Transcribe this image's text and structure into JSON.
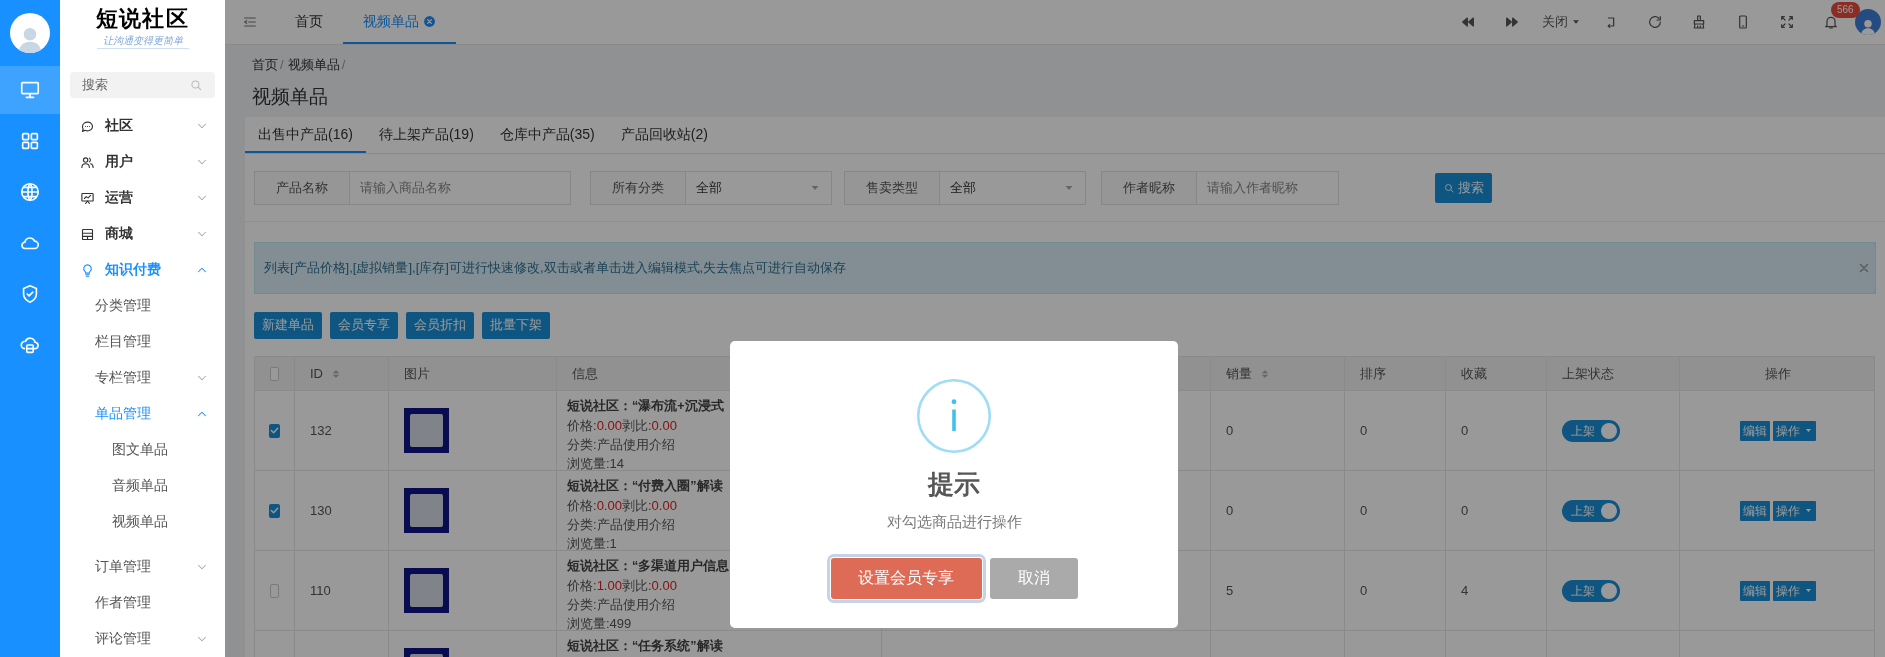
{
  "rail": {
    "items": [
      {
        "selected": true
      },
      {
        "selected": false
      },
      {
        "selected": false
      },
      {
        "selected": false
      },
      {
        "selected": false
      },
      {
        "selected": false
      }
    ]
  },
  "logo": {
    "title": "短说社区",
    "slogan": "让沟通变得更简单"
  },
  "sidebar": {
    "search_placeholder": "搜索",
    "items": [
      {
        "label": "社区",
        "active": false,
        "expanded": false
      },
      {
        "label": "用户",
        "active": false,
        "expanded": false
      },
      {
        "label": "运营",
        "active": false,
        "expanded": false
      },
      {
        "label": "商城",
        "active": false,
        "expanded": false
      },
      {
        "label": "知识付费",
        "active": true,
        "expanded": true,
        "children": [
          {
            "label": "分类管理",
            "active": false
          },
          {
            "label": "栏目管理",
            "active": false
          },
          {
            "label": "专栏管理",
            "active": false,
            "expanded": false
          },
          {
            "label": "单品管理",
            "active": true,
            "expanded": true,
            "children": [
              {
                "label": "图文单品",
                "active": false
              },
              {
                "label": "音频单品",
                "active": false
              },
              {
                "label": "视频单品",
                "active": false
              }
            ]
          },
          {
            "label": "订单管理",
            "active": false,
            "expanded": false
          },
          {
            "label": "作者管理",
            "active": false
          },
          {
            "label": "评论管理",
            "active": false,
            "expanded": false
          }
        ]
      }
    ]
  },
  "top_tabs": [
    {
      "label": "首页",
      "selected": false,
      "closable": false
    },
    {
      "label": "视频单品",
      "selected": true,
      "closable": true
    }
  ],
  "toolbar": {
    "close_menu": "关闭",
    "notification_count": "566"
  },
  "breadcrumb": [
    {
      "label": "首页",
      "separator": "/"
    },
    {
      "label": "视频单品",
      "separator": "/"
    }
  ],
  "page_title": "视频单品",
  "content_tabs": [
    {
      "label": "出售中产品(16)",
      "selected": true
    },
    {
      "label": "待上架产品(19)",
      "selected": false
    },
    {
      "label": "仓库中产品(35)",
      "selected": false
    },
    {
      "label": "产品回收站(2)",
      "selected": false
    }
  ],
  "filters": [
    {
      "kind": "text",
      "label": "产品名称",
      "placeholder": "请输入商品名称"
    },
    {
      "kind": "select",
      "label": "所有分类",
      "value": "全部"
    },
    {
      "kind": "select",
      "label": "售卖类型",
      "value": "全部"
    },
    {
      "kind": "text",
      "label": "作者昵称",
      "placeholder": "请输入作者昵称"
    }
  ],
  "search_button": "搜索",
  "notice": "列表[产品价格],[虚拟销量],[库存]可进行快速修改,双击或者单击进入编辑模式,失去焦点可进行自动保存",
  "actions": [
    "新建单品",
    "会员专享",
    "会员折扣",
    "批量下架"
  ],
  "table": {
    "all_checked": false,
    "columns": [
      {
        "label": "ID",
        "sortable": true
      },
      {
        "label": "图片",
        "sortable": false
      },
      {
        "label": "信息",
        "sortable": false
      },
      {
        "label": "销量",
        "sortable": true
      },
      {
        "label": "排序",
        "sortable": false
      },
      {
        "label": "收藏",
        "sortable": false
      },
      {
        "label": "上架状态",
        "sortable": false
      },
      {
        "label": "操作",
        "sortable": false
      }
    ],
    "rows": [
      {
        "checked": true,
        "id": "132",
        "title": "短说社区：“瀑布流+沉浸式",
        "price_label": "价格:",
        "price": "0.00",
        "ratio_label": "剥比:",
        "ratio": "0.00",
        "category": "分类:产品使用介绍",
        "views": "浏览量:14",
        "sales": "0",
        "sort": "0",
        "favorites": "0",
        "status": {
          "label": "上架",
          "on": true
        },
        "buttons": [
          "编辑",
          "操作"
        ]
      },
      {
        "checked": true,
        "id": "130",
        "title": "短说社区：“付费入圈”解读",
        "price_label": "价格:",
        "price": "0.00",
        "ratio_label": "剥比:",
        "ratio": "0.00",
        "category": "分类:产品使用介绍",
        "views": "浏览量:1",
        "sales": "0",
        "sort": "0",
        "favorites": "0",
        "status": {
          "label": "上架",
          "on": true
        },
        "buttons": [
          "编辑",
          "操作"
        ]
      },
      {
        "checked": false,
        "id": "110",
        "title": "短说社区：“多渠道用户信息",
        "price_label": "价格:",
        "price": "1.00",
        "ratio_label": "剥比:",
        "ratio": "0.00",
        "category": "分类:产品使用介绍",
        "views": "浏览量:499",
        "sales": "5",
        "sort": "0",
        "favorites": "4",
        "status": {
          "label": "上架",
          "on": true
        },
        "buttons": [
          "编辑",
          "操作"
        ]
      },
      {
        "title": "短说社区：“任务系统”解读"
      }
    ]
  },
  "dialog": {
    "title": "提示",
    "message": "对勾选商品进行操作",
    "buttons": [
      {
        "kind": "primary",
        "label": "设置会员专享",
        "focused": true
      },
      {
        "kind": "cancel",
        "label": "取消",
        "focused": false
      }
    ]
  }
}
